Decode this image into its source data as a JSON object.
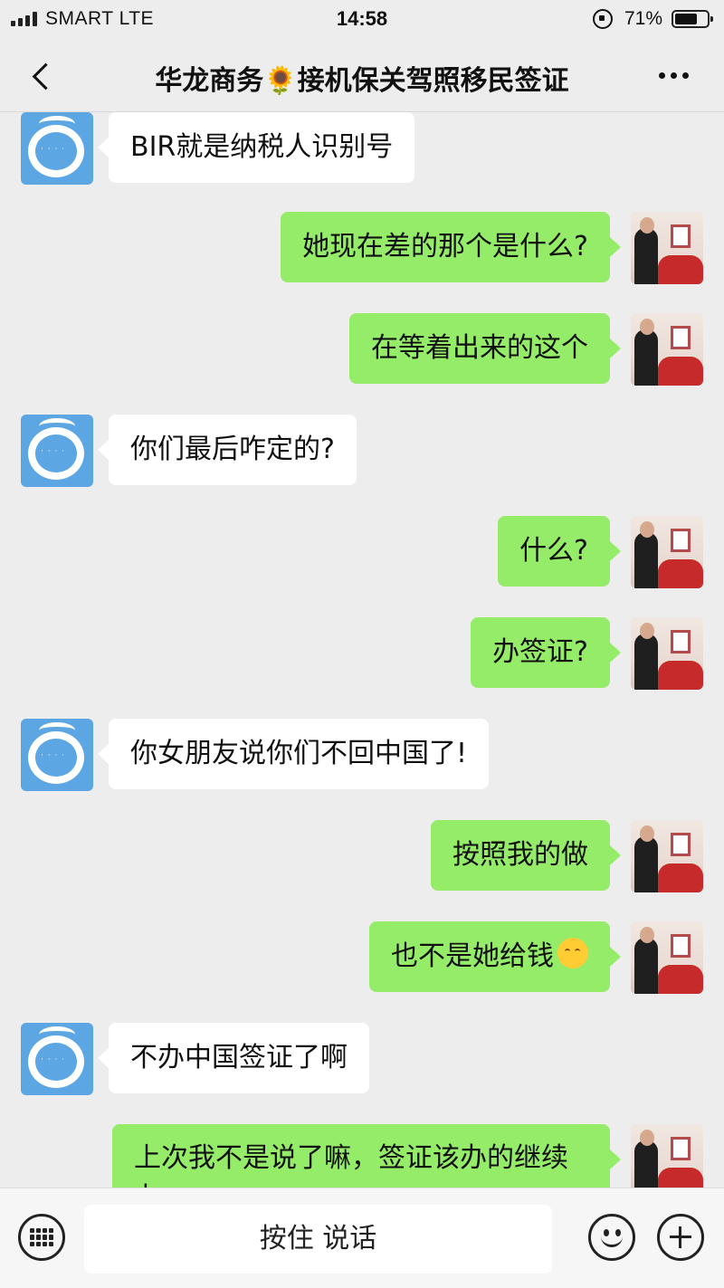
{
  "status_bar": {
    "carrier": "SMART   LTE",
    "time": "14:58",
    "battery_percent": "71%",
    "battery_level": 0.71,
    "icons": [
      "signal-icon",
      "orientation-lock-icon",
      "battery-icon"
    ]
  },
  "header": {
    "back_icon": "chevron-left-icon",
    "title": "华龙商务🌻接机保关驾照移民签证",
    "more_icon": "ellipsis-icon"
  },
  "colors": {
    "background": "#ededed",
    "incoming_bubble": "#ffffff",
    "outgoing_bubble": "#95ec69"
  },
  "messages": [
    {
      "side": "in",
      "text": "BIR就是纳税人识别号"
    },
    {
      "side": "out",
      "text": "她现在差的那个是什么?"
    },
    {
      "side": "out",
      "text": "在等着出来的这个"
    },
    {
      "side": "in",
      "text": "你们最后咋定的?"
    },
    {
      "side": "out",
      "text": "什么?"
    },
    {
      "side": "out",
      "text": "办签证?"
    },
    {
      "side": "in",
      "text": "你女朋友说你们不回中国了!"
    },
    {
      "side": "out",
      "text": "按照我的做"
    },
    {
      "side": "out",
      "text": "也不是她给钱",
      "emoji": "thinking-face-emoji"
    },
    {
      "side": "in",
      "text": "不办中国签证了啊"
    },
    {
      "side": "out",
      "text": "上次我不是说了嘛，签证该办的继续办"
    }
  ],
  "input_bar": {
    "keyboard_icon": "keyboard-icon",
    "voice_button_label": "按住 说话",
    "emoji_icon": "emoji-icon",
    "plus_icon": "plus-icon"
  }
}
